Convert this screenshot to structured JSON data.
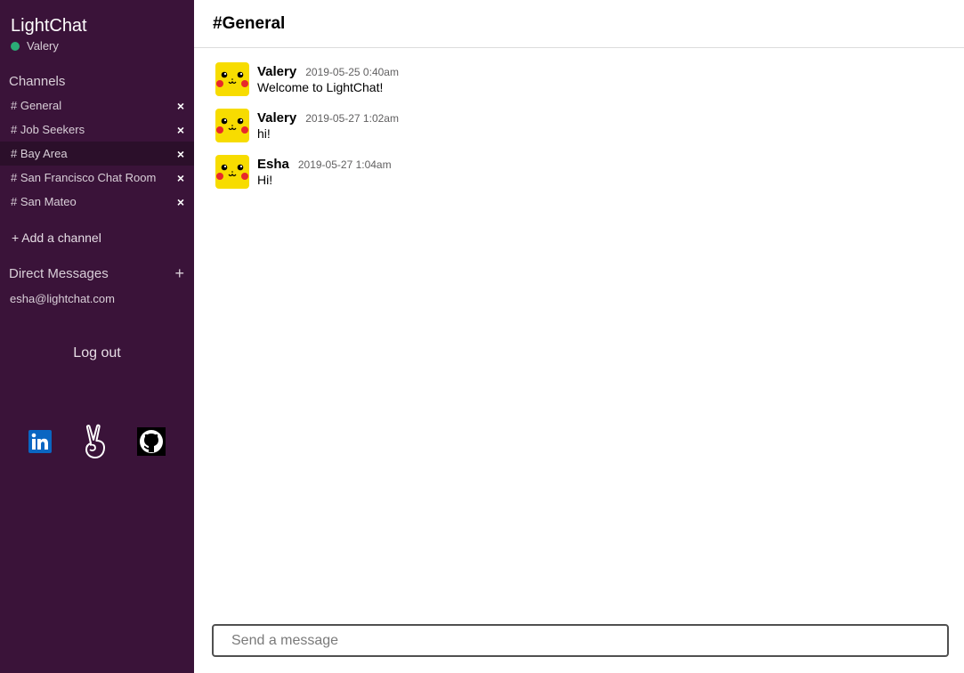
{
  "app": {
    "title": "LightChat"
  },
  "user": {
    "name": "Valery",
    "status_color": "#2bac76"
  },
  "sidebar": {
    "channels_title": "Channels",
    "channels": [
      {
        "label": "# General",
        "remove": "×",
        "active": false
      },
      {
        "label": "# Job Seekers",
        "remove": "×",
        "active": false
      },
      {
        "label": "# Bay Area",
        "remove": "×",
        "active": true
      },
      {
        "label": "# San Francisco Chat Room",
        "remove": "×",
        "active": false
      },
      {
        "label": "# San Mateo",
        "remove": "×",
        "active": false
      }
    ],
    "add_channel": "+ Add a channel",
    "dm_title": "Direct Messages",
    "dm_add": "+",
    "dms": [
      {
        "label": "esha@lightchat.com"
      }
    ],
    "logout": "Log out",
    "social": [
      "linkedin-icon",
      "angellist-icon",
      "github-icon"
    ]
  },
  "main": {
    "channel_title": "#General",
    "messages": [
      {
        "author": "Valery",
        "time": "2019-05-25 0:40am",
        "text": "Welcome to LightChat!"
      },
      {
        "author": "Valery",
        "time": "2019-05-27 1:02am",
        "text": "hi!"
      },
      {
        "author": "Esha",
        "time": "2019-05-27 1:04am",
        "text": "Hi!"
      }
    ],
    "composer_placeholder": "Send a message"
  },
  "colors": {
    "sidebar": "#3a1339",
    "active_channel": "#2b0f2a",
    "avatar": "#f7dc00"
  }
}
